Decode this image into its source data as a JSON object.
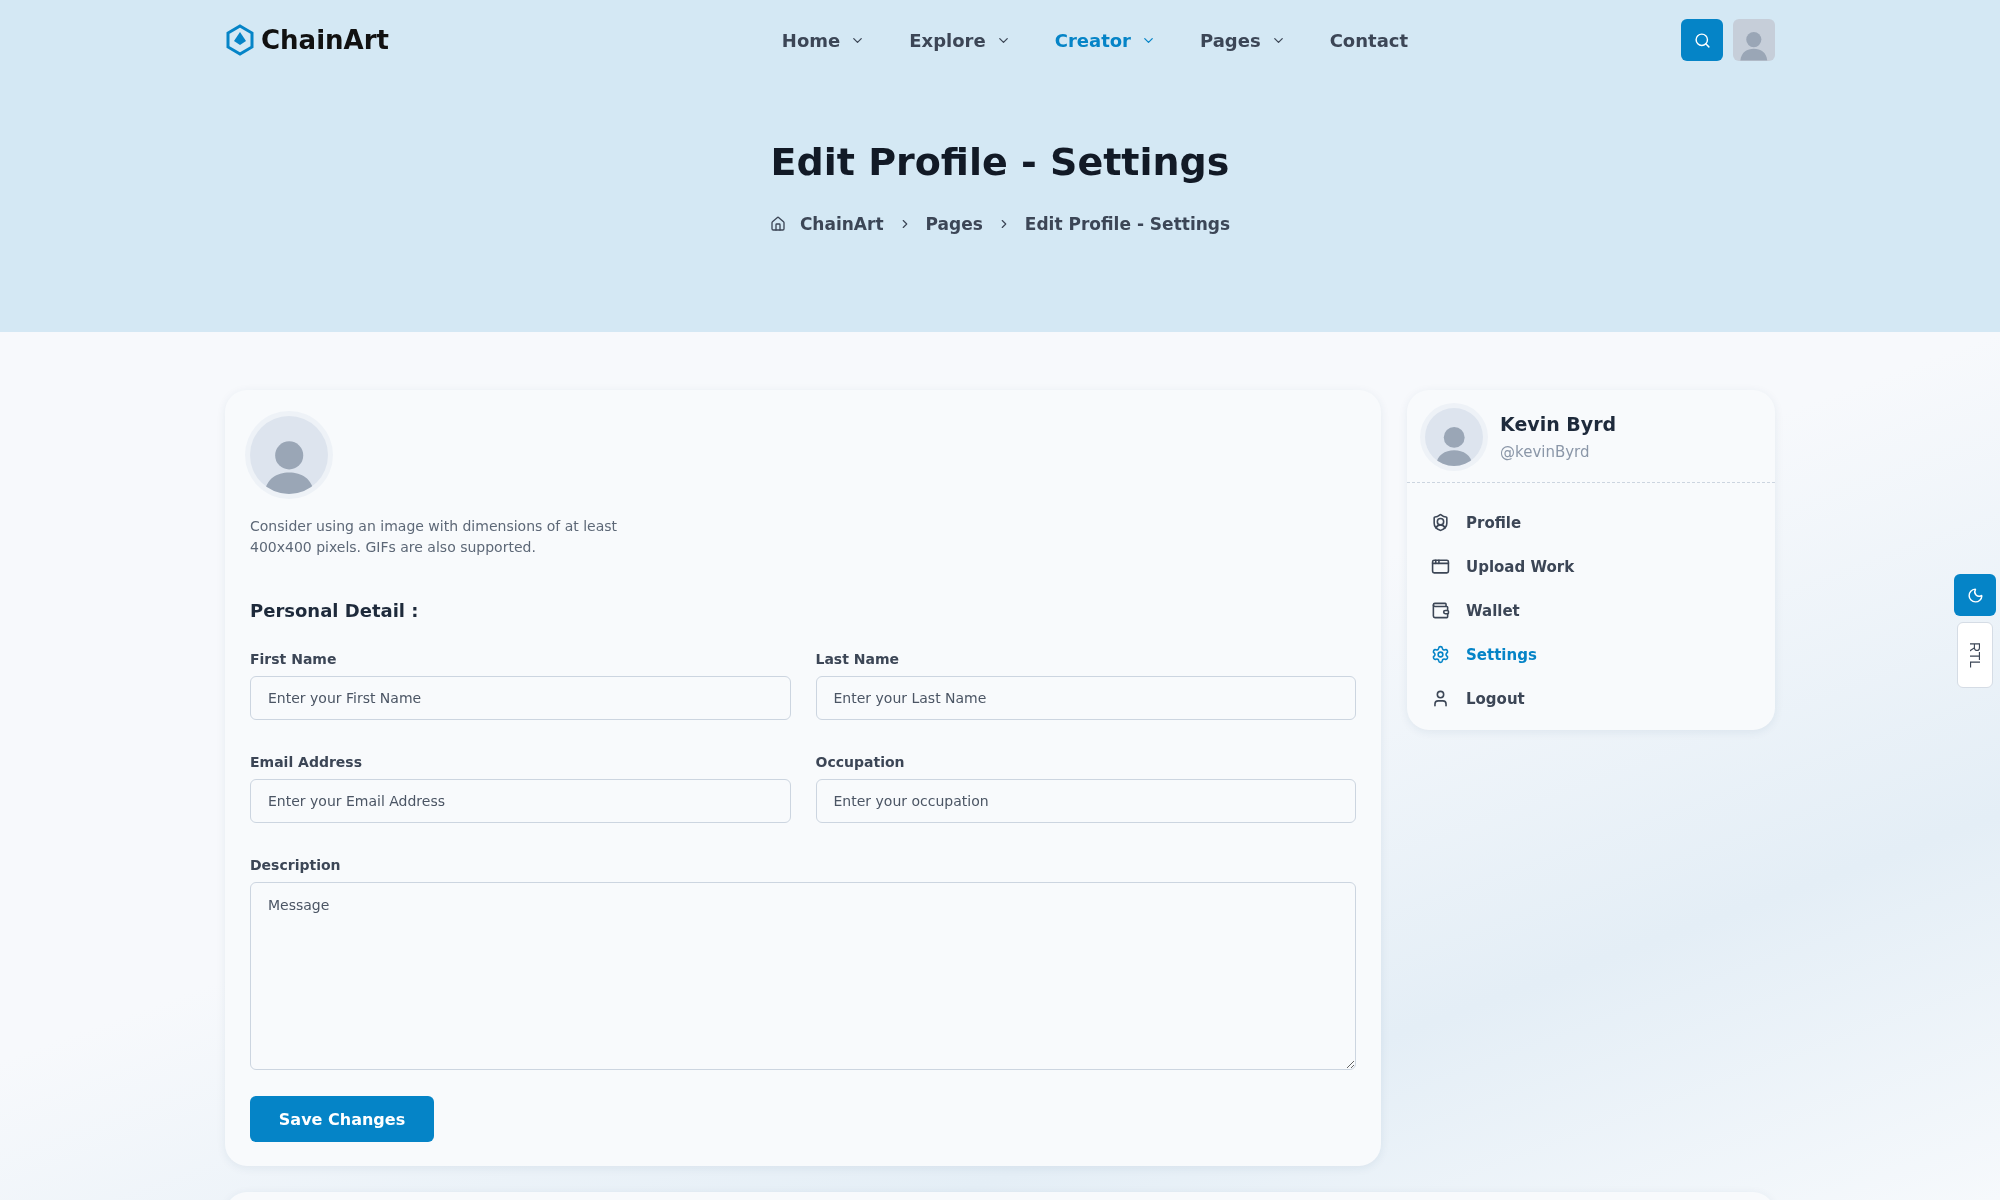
{
  "brand": {
    "name": "ChainArt"
  },
  "nav": [
    {
      "label": "Home",
      "dropdown": true,
      "selected": false
    },
    {
      "label": "Explore",
      "dropdown": true,
      "selected": false
    },
    {
      "label": "Creator",
      "dropdown": true,
      "selected": true
    },
    {
      "label": "Pages",
      "dropdown": true,
      "selected": false
    },
    {
      "label": "Contact",
      "dropdown": false,
      "selected": false
    }
  ],
  "hero": {
    "title": "Edit Profile - Settings",
    "breadcrumb": [
      "ChainArt",
      "Pages",
      "Edit Profile - Settings"
    ]
  },
  "form": {
    "hint": "Consider using an image with dimensions of at least 400x400 pixels. GIFs are also supported.",
    "section_title": "Personal Detail :",
    "fields": [
      {
        "label": "First Name",
        "placeholder": "Enter your First Name",
        "kind": "input"
      },
      {
        "label": "Last Name",
        "placeholder": "Enter your Last Name",
        "kind": "input"
      },
      {
        "label": "Email Address",
        "placeholder": "Enter your Email Address",
        "kind": "input"
      },
      {
        "label": "Occupation",
        "placeholder": "Enter your occupation",
        "kind": "input"
      },
      {
        "label": "Description",
        "placeholder": "Message",
        "kind": "textarea"
      }
    ],
    "submit": "Save Changes"
  },
  "profile": {
    "name": "Kevin Byrd",
    "handle": "@kevinByrd"
  },
  "menu": [
    {
      "label": "Profile",
      "selected": false
    },
    {
      "label": "Upload Work",
      "selected": false
    },
    {
      "label": "Wallet",
      "selected": false
    },
    {
      "label": "Settings",
      "selected": true
    },
    {
      "label": "Logout",
      "selected": false
    }
  ],
  "side_tools": {
    "rtl": "RTL"
  }
}
